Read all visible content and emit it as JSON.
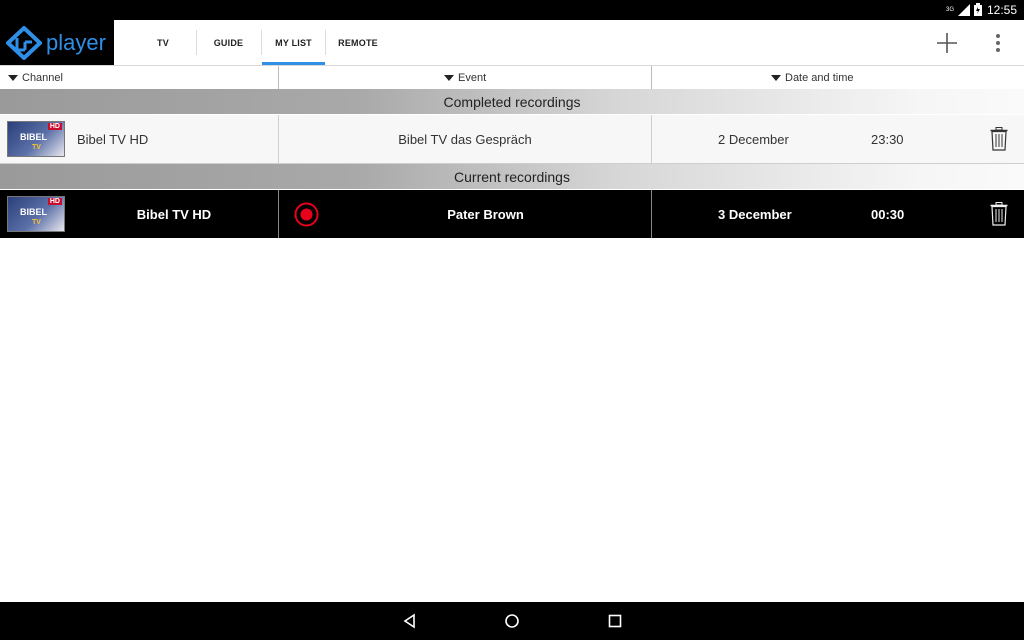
{
  "statusbar": {
    "time": "12:55",
    "network": "3G"
  },
  "app": {
    "name": "player"
  },
  "tabs": [
    {
      "label": "TV",
      "active": false
    },
    {
      "label": "GUIDE",
      "active": false
    },
    {
      "label": "MY LIST",
      "active": true
    },
    {
      "label": "REMOTE",
      "active": false
    }
  ],
  "columns": {
    "channel": "Channel",
    "event": "Event",
    "datetime": "Date and time"
  },
  "sections": {
    "completed": "Completed recordings",
    "current": "Current recordings"
  },
  "completed_recordings": [
    {
      "channel": "Bibel TV HD",
      "event": "Bibel TV das Gespräch",
      "date": "2 December",
      "time": "23:30"
    }
  ],
  "current_recordings": [
    {
      "channel": "Bibel TV HD",
      "event": "Pater Brown",
      "date": "3 December",
      "time": "00:30",
      "recording": true
    }
  ],
  "thumbnail": {
    "logo_text": "BIBEL",
    "badge": "HD",
    "sub": "TV"
  },
  "colors": {
    "accent": "#2f8fe6",
    "record": "#e8001c"
  }
}
